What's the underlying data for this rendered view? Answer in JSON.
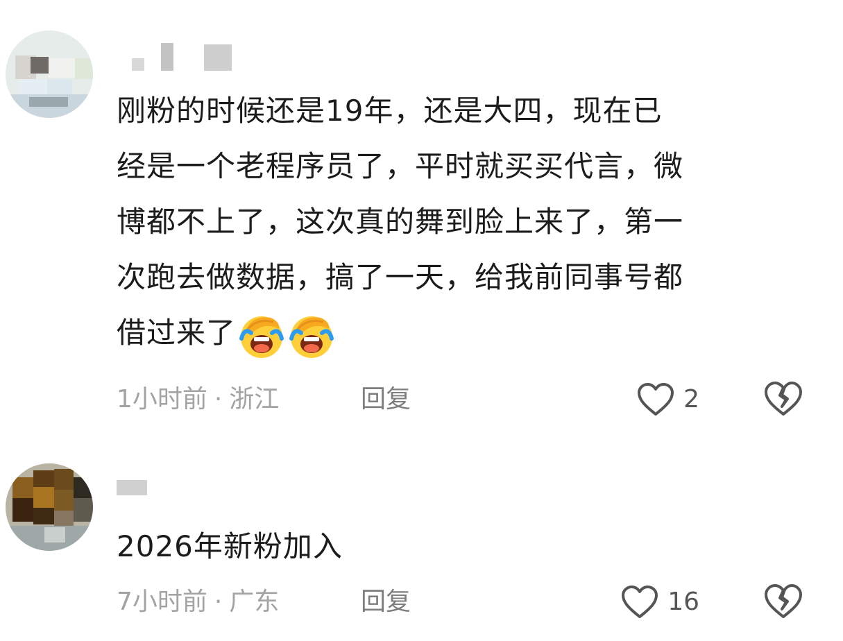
{
  "comments": [
    {
      "text_lines": [
        "刚粉的时候还是19年，还是大四，现在已",
        "经是一个老程序员了，平时就买买代言，微",
        "博都不上了，这次真的舞到脸上来了，第一",
        "次跑去做数据，搞了一天，给我前同事号都",
        "借过来了"
      ],
      "emojis": [
        "facepalm-laugh-emoji",
        "facepalm-laugh-emoji"
      ],
      "time": "1小时前",
      "separator": "·",
      "location": "浙江",
      "reply_label": "回复",
      "likes": "2"
    },
    {
      "text": "2026年新粉加入",
      "time": "7小时前",
      "separator": "·",
      "location": "广东",
      "reply_label": "回复",
      "likes": "16"
    }
  ],
  "icons": {
    "like": "heart-outline-icon",
    "dislike": "broken-heart-icon"
  },
  "colors": {
    "text": "#1c1c1c",
    "meta": "#a3a3a3",
    "icon": "#5a5a5a"
  }
}
